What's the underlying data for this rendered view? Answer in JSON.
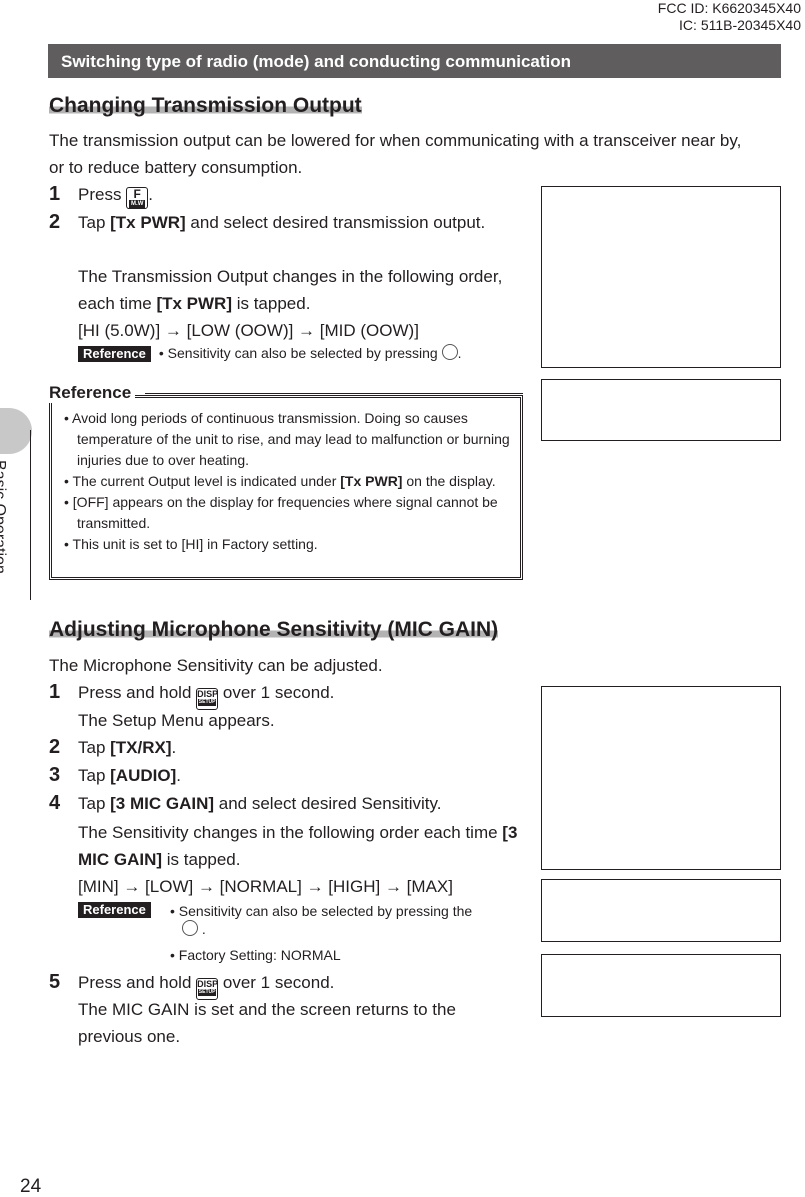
{
  "header": {
    "fcc_id": "FCC ID: K6620345X40",
    "ic": "IC: 511B-20345X40"
  },
  "banner": "Switching type of radio (mode) and conducting communication",
  "sidebar": {
    "section": "Basic Operation"
  },
  "page_number": "24",
  "section1": {
    "title": "Changing Transmission Output",
    "intro": "The transmission output can be lowered for when communicating with a transceiver near by, or to reduce battery consumption.",
    "step1": {
      "num": "1",
      "text": "Press",
      "key": "F",
      "key_sub": "M.W",
      "end": "."
    },
    "step2": {
      "num": "2",
      "pre": "Tap ",
      "bold": "[Tx PWR]",
      "post": " and select desired transmission output."
    },
    "step2_note_a": "The Transmission Output changes in the following order, each time ",
    "step2_note_bold": "[Tx PWR]",
    "step2_note_b": " is tapped.",
    "sequence": "[HI (5.0W)] → [LOW (OOW)] → [MID (OOW)]",
    "reference_badge": "Reference",
    "reference_note": "• Sensitivity can also be selected by pressing",
    "reference_end": "."
  },
  "reference_box": {
    "title": "Reference",
    "items": [
      {
        "text": "Avoid long periods of continuous transmission. Doing so causes temperature of the unit to rise, and may lead to malfunction or burning injuries due to over heating."
      },
      {
        "pre": "The current Output level is indicated under ",
        "bold": "[Tx PWR]",
        "post": " on the display."
      },
      {
        "text": "[OFF] appears on the display for frequencies where signal cannot be transmitted."
      },
      {
        "text": "This unit is set to [HI] in Factory setting."
      }
    ]
  },
  "section2": {
    "title": "Adjusting Microphone Sensitivity (MIC GAIN)",
    "intro": "The Microphone Sensitivity can be adjusted.",
    "step1": {
      "num": "1",
      "pre": "Press and hold",
      "key": "DISP",
      "key_sub": "SETUP",
      "post": "over 1 second.",
      "note": "The Setup Menu appears."
    },
    "step2": {
      "num": "2",
      "pre": "Tap ",
      "bold": "[TX/RX]",
      "post": "."
    },
    "step3": {
      "num": "3",
      "pre": "Tap ",
      "bold": "[AUDIO]",
      "post": "."
    },
    "step4": {
      "num": "4",
      "pre": "Tap ",
      "bold": "[3 MIC GAIN]",
      "post": " and select desired Sensitivity.",
      "note_a": "The Sensitivity changes in the following order each time ",
      "note_bold": "[3 MIC GAIN]",
      "note_b": " is tapped."
    },
    "sequence": "[MIN] → [LOW] → [NORMAL] → [HIGH] → [MAX]",
    "reference_badge": "Reference",
    "reference_note1": "• Sensitivity can also be selected by pressing the",
    "reference_note2": "• Factory Setting: NORMAL",
    "step5": {
      "num": "5",
      "pre": "Press and hold",
      "key": "DISP",
      "key_sub": "SETUP",
      "post": "over 1 second.",
      "note": "The MIC GAIN is set and the screen returns to the previous one."
    }
  },
  "colors": {
    "banner": "#5f5d5e",
    "heading_underline": "#b3b3b3",
    "tab": "#c8c8c8"
  }
}
